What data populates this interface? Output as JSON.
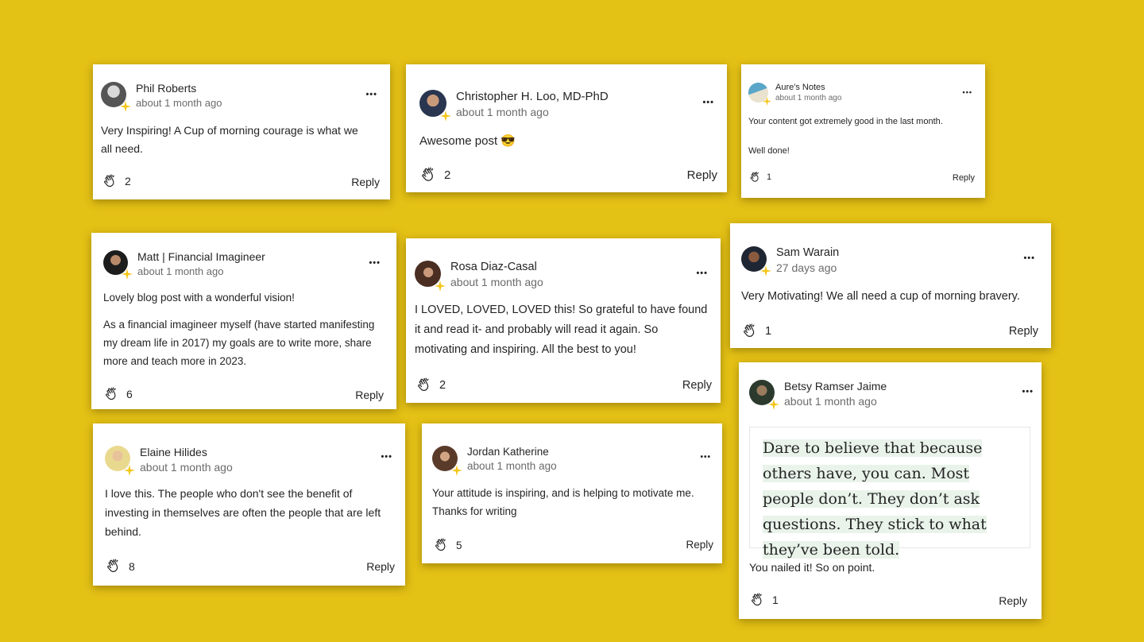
{
  "comments": [
    {
      "author": "Phil Roberts",
      "time": "about 1 month ago",
      "body": [
        "Very Inspiring! A Cup of morning courage is what we all need."
      ],
      "claps": "2",
      "reply_label": "Reply",
      "more_label": "•••"
    },
    {
      "author": "Christopher H. Loo, MD-PhD",
      "time": "about 1 month ago",
      "body": [
        "Awesome post 😎"
      ],
      "claps": "2",
      "reply_label": "Reply",
      "more_label": "•••"
    },
    {
      "author": "Aure's Notes",
      "time": "about 1 month ago",
      "body": [
        "Your content got extremely good in the last month.",
        "Well done!"
      ],
      "claps": "1",
      "reply_label": "Reply",
      "more_label": "•••"
    },
    {
      "author": "Matt | Financial Imagineer",
      "time": "about 1 month ago",
      "body": [
        "Lovely blog post with a wonderful vision!",
        "As a financial imagineer myself (have started manifesting my dream life in 2017) my goals are to write more, share more and teach more in 2023."
      ],
      "claps": "6",
      "reply_label": "Reply",
      "more_label": "•••"
    },
    {
      "author": "Rosa Diaz-Casal",
      "time": "about 1 month ago",
      "body": [
        "I LOVED, LOVED, LOVED this! So grateful to have found it and read it- and probably will read it again. So motivating and inspiring. All the best to you!"
      ],
      "claps": "2",
      "reply_label": "Reply",
      "more_label": "•••"
    },
    {
      "author": "Sam Warain",
      "time": "27 days ago",
      "body": [
        "Very Motivating! We all need a cup of morning bravery."
      ],
      "claps": "1",
      "reply_label": "Reply",
      "more_label": "•••"
    },
    {
      "author": "Betsy Ramser Jaime",
      "time": "about 1 month ago",
      "quote": "Dare to believe that because others have, you can. Most people don’t. They don’t ask questions. They stick to what they’ve been told.",
      "body": [
        "You nailed it! So on point."
      ],
      "claps": "1",
      "reply_label": "Reply",
      "more_label": "•••"
    },
    {
      "author": "Elaine Hilides",
      "time": "about 1 month ago",
      "body": [
        "I love this. The people who don't see the benefit of investing in themselves are often the people that are left behind."
      ],
      "claps": "8",
      "reply_label": "Reply",
      "more_label": "•••"
    },
    {
      "author": "Jordan Katherine",
      "time": "about 1 month ago",
      "body": [
        "Your attitude is inspiring, and is helping to motivate me. Thanks for writing"
      ],
      "claps": "5",
      "reply_label": "Reply",
      "more_label": "•••"
    }
  ],
  "colors": {
    "background": "#e4c115",
    "member_star": "#f5c518",
    "highlight": "#e9f3ea"
  },
  "icons": {
    "clap": "clap-icon",
    "more": "more-options-icon",
    "member": "member-star-icon"
  }
}
